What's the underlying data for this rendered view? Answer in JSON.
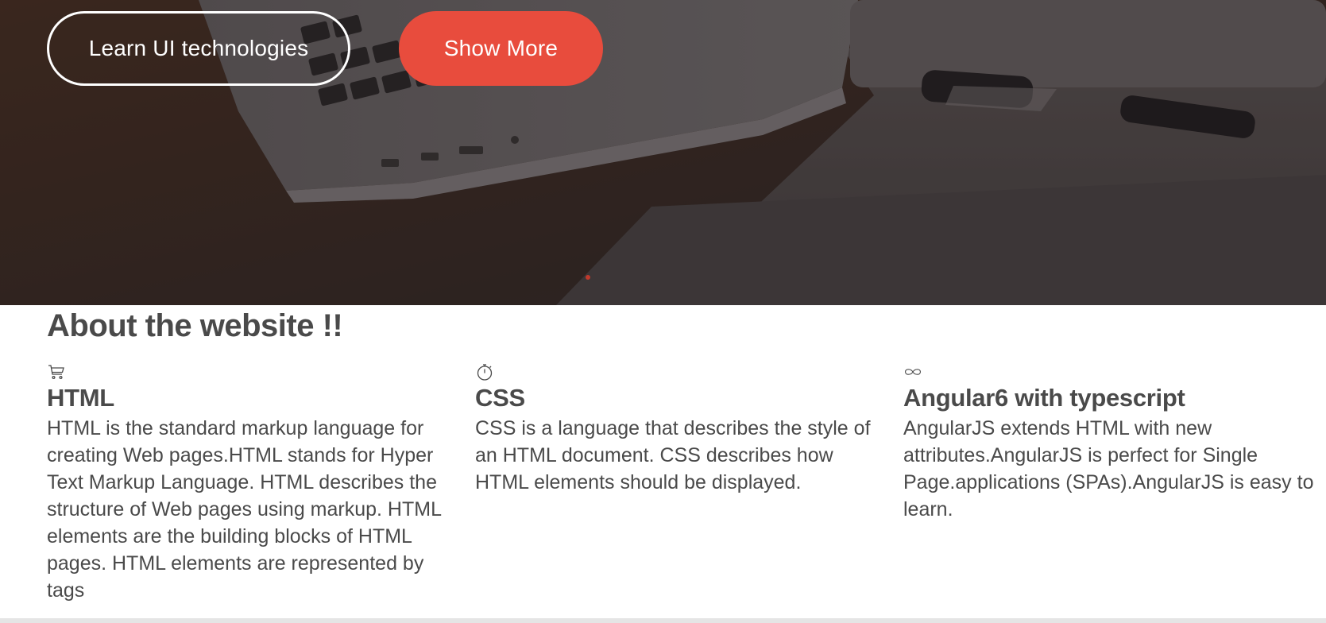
{
  "hero": {
    "learn_button": "Learn UI technologies",
    "show_more_button": "Show More",
    "accent_color": "#e84c3d"
  },
  "about": {
    "title": "About the website !!",
    "features": [
      {
        "icon": "cart-icon",
        "title": "HTML",
        "text": "HTML is the standard markup language for creating Web pages.HTML stands for Hyper Text Markup Language. HTML describes the structure of Web pages using markup. HTML elements are the building blocks of HTML pages. HTML elements are represented by tags"
      },
      {
        "icon": "stopwatch-icon",
        "title": "CSS",
        "text": "CSS is a language that describes the style of an HTML document. CSS describes how HTML elements should be displayed."
      },
      {
        "icon": "infinity-icon",
        "title": "Angular6 with typescript",
        "text": "AngularJS extends HTML with new attributes.AngularJS is perfect for Single Page.applications (SPAs).AngularJS is easy to learn."
      }
    ]
  }
}
